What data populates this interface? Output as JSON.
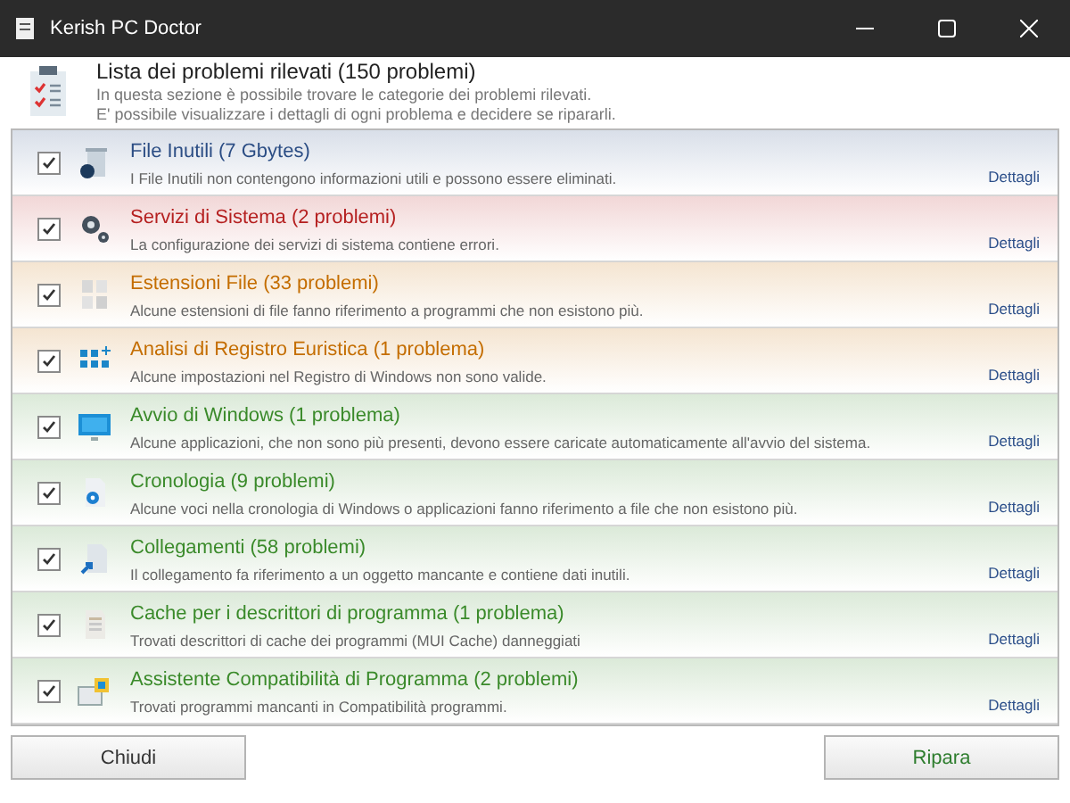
{
  "window": {
    "title": "Kerish PC Doctor"
  },
  "header": {
    "title": "Lista dei problemi rilevati (150 problemi)",
    "lines": [
      "In questa sezione è possibile trovare le categorie dei problemi rilevati.",
      "E' possibile visualizzare i dettagli di ogni problema e decidere se ripararli."
    ]
  },
  "problems": [
    {
      "title": "File Inutili (7 Gbytes)",
      "description": "I File Inutili non contengono informazioni utili e possono essere eliminati.",
      "color": "#2b4d84",
      "checked": true,
      "link": "Dettagli"
    },
    {
      "title": "Servizi di Sistema (2 problemi)",
      "description": "La configurazione dei servizi di sistema contiene errori.",
      "color": "#b52020",
      "checked": true,
      "link": "Dettagli"
    },
    {
      "title": "Estensioni File (33 problemi)",
      "description": "Alcune estensioni di file fanno riferimento a programmi che non esistono più.",
      "color": "#c46d00",
      "checked": true,
      "link": "Dettagli"
    },
    {
      "title": "Analisi di Registro Euristica (1 problema)",
      "description": "Alcune impostazioni nel Registro di Windows non sono valide.",
      "color": "#c46d00",
      "checked": true,
      "link": "Dettagli"
    },
    {
      "title": "Avvio di Windows (1 problema)",
      "description": "Alcune applicazioni, che non sono più presenti, devono essere caricate automaticamente all'avvio del sistema.",
      "color": "#3a8a2a",
      "checked": true,
      "link": "Dettagli"
    },
    {
      "title": "Cronologia (9 problemi)",
      "description": "Alcune voci nella cronologia di Windows o applicazioni fanno riferimento a file che non esistono più.",
      "color": "#3a8a2a",
      "checked": true,
      "link": "Dettagli"
    },
    {
      "title": "Collegamenti (58 problemi)",
      "description": "Il collegamento fa riferimento a un oggetto mancante e contiene dati inutili.",
      "color": "#3a8a2a",
      "checked": true,
      "link": "Dettagli"
    },
    {
      "title": "Cache per i descrittori di programma (1 problema)",
      "description": "Trovati descrittori di cache dei programmi (MUI Cache) danneggiati",
      "color": "#3a8a2a",
      "checked": true,
      "link": "Dettagli"
    },
    {
      "title": "Assistente Compatibilità di Programma (2 problemi)",
      "description": "Trovati programmi mancanti in Compatibilità programmi.",
      "color": "#3a8a2a",
      "checked": true,
      "link": "Dettagli"
    }
  ],
  "buttons": [
    {
      "label": "Chiudi",
      "kind": "secondary"
    },
    {
      "label": "Ripara",
      "kind": "primary"
    }
  ]
}
